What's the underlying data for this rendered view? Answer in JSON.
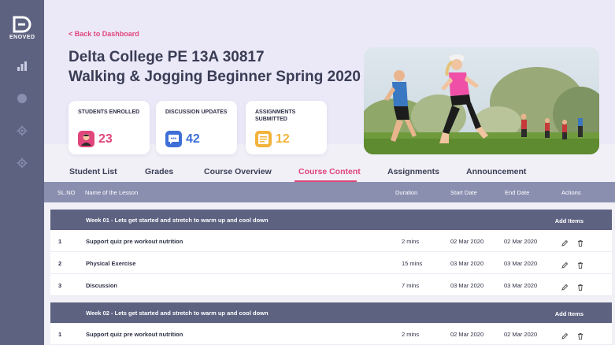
{
  "sidebar": {
    "logo_text": "ENOVED",
    "icons": [
      "bar-chart-icon",
      "circle-icon",
      "gear-icon",
      "gear-icon"
    ]
  },
  "header": {
    "back_link": "< Back to Dashboard",
    "title_line1": "Delta College PE 13A 30817",
    "title_line2": "Walking & Jogging Beginner Spring 2020"
  },
  "stats": [
    {
      "label": "Students Enrolled",
      "value": "23",
      "color": "#e0457b",
      "icon": "student-avatar-icon"
    },
    {
      "label": "Discussion Updates",
      "value": "42",
      "color": "#3d6fd6",
      "icon": "chat-bubble-icon"
    },
    {
      "label": "Assignments Submitted",
      "value": "12",
      "color": "#f2b33b",
      "icon": "document-icon"
    }
  ],
  "tabs": [
    "Student List",
    "Grades",
    "Course Overview",
    "Course Content",
    "Assignments",
    "Announcement"
  ],
  "active_tab": "Course Content",
  "table": {
    "columns": [
      "SL.NO",
      "Name of the Lesson",
      "Duration",
      "Start Date",
      "End Date",
      "Actions"
    ],
    "weeks": [
      {
        "title": "Week 01 - Lets get started and stretch to warm up and cool down",
        "add_label": "Add Items",
        "rows": [
          {
            "no": "1",
            "lesson": "Support quiz pre workout nutrition",
            "duration": "2 mins",
            "start": "02 Mar 2020",
            "end": "02 Mar 2020"
          },
          {
            "no": "2",
            "lesson": "Physical Exercise",
            "duration": "15 mins",
            "start": "03 Mar 2020",
            "end": "03 Mar 2020"
          },
          {
            "no": "3",
            "lesson": "Discussion",
            "duration": "7 mins",
            "start": "03 Mar 2020",
            "end": "03 Mar 2020"
          }
        ]
      },
      {
        "title": "Week 02 - Lets get started and stretch to warm up and cool down",
        "add_label": "Add Items",
        "rows": [
          {
            "no": "1",
            "lesson": "Support quiz pre workout nutrition",
            "duration": "2 mins",
            "start": "02 Mar 2020",
            "end": "02 Mar 2020"
          }
        ]
      }
    ]
  },
  "colors": {
    "accent": "#e0457b",
    "sidebar": "#5d6281",
    "table_header": "#8a8fb0"
  }
}
